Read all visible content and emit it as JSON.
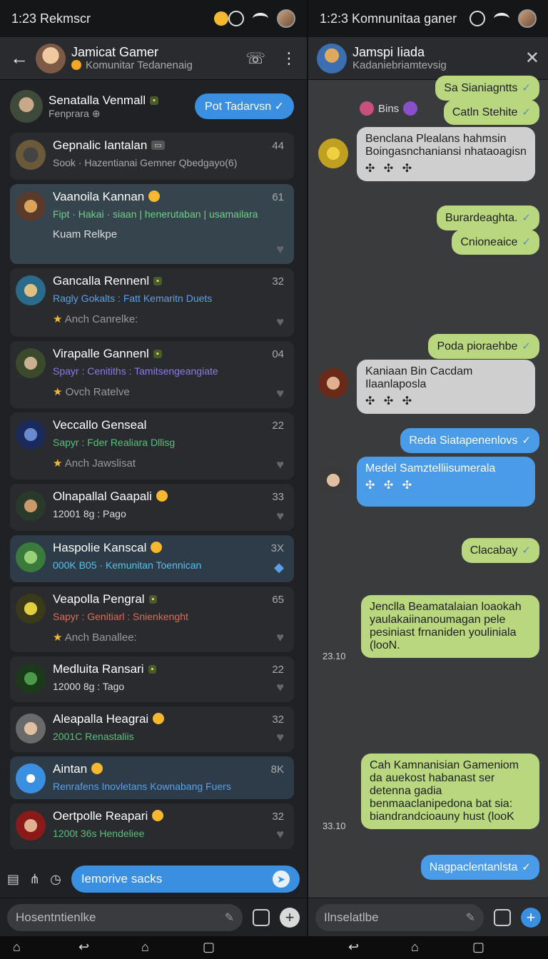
{
  "left": {
    "status": {
      "time": "1:23 Rekmscr"
    },
    "header": {
      "title": "Jamicat Gamer",
      "subtitle": "Komunitar Tedanenaig"
    },
    "pinned": {
      "title": "Senatalla Venmall",
      "subtitle": "Fenprara",
      "button": "Pot Tadarvsn"
    },
    "cards": [
      {
        "title": "Gepnalic Iantalan",
        "line": "Sook · Hazentianai Gemner Qbedgayo(6)",
        "meta": "",
        "count": "44",
        "style": ""
      },
      {
        "title": "Vaanoila Kannan",
        "line": "Fipt · Hakai · siaan | henerutaban | usamailara",
        "meta": "Kuam Relkpe",
        "count": "61",
        "style": "hl"
      },
      {
        "title": "Gancalla Rennenl",
        "line": "Ragly Gokalts : Fatt Kemaritn Duets",
        "meta": "Anch Canrelke:",
        "count": "32",
        "style": ""
      },
      {
        "title": "Virapalle Gannenl",
        "line": "Spayr : Cenitiths : Tamitsengeangiate",
        "meta": "Ovch Ratelve",
        "count": "04",
        "style": ""
      },
      {
        "title": "Veccallo Genseal",
        "line": "Sapyr : Fder Realiara Dllisg",
        "meta": "Anch Jawslisat",
        "count": "22",
        "style": ""
      },
      {
        "title": "Olnapallal Gaapali",
        "line": "12001 8g : Pago",
        "meta": "",
        "count": "33",
        "style": ""
      },
      {
        "title": "Haspolie Kanscal",
        "line": "000K B05 · Kemunitan Toennican",
        "meta": "",
        "count": "3X",
        "style": "blue"
      },
      {
        "title": "Veapolla Pengral",
        "line": "Sapyr : Genitiarl : Snienkenght",
        "meta": "Anch Banallee:",
        "count": "65",
        "style": ""
      },
      {
        "title": "Medluita Ransari",
        "line": "12000 8g : Tago",
        "meta": "",
        "count": "22",
        "style": ""
      },
      {
        "title": "Aleapalla Heagrai",
        "line": "2001C Renastaliis",
        "meta": "",
        "count": "32",
        "style": ""
      },
      {
        "title": "Aintan",
        "line": "Renrafens Inovletans Kownabang Fuers",
        "meta": "",
        "count": "8K",
        "style": "blue"
      },
      {
        "title": "Oertpolle Reapari",
        "line": "1200t 36s Hendeliee",
        "meta": "",
        "count": "32",
        "style": ""
      }
    ],
    "suggest": "Iemorive sacks",
    "input_placeholder": "Hosentntienlke"
  },
  "right": {
    "status": {
      "time": "1:2:3 Komnunitaa ganer"
    },
    "header": {
      "title": "Jamspi Iiada",
      "subtitle": "Kadaniebriamtevsig"
    },
    "messages": {
      "m1": "Sa Sianiagntts",
      "bins": "Bins",
      "m2": "Catln Stehite",
      "m3": "Benclana Plealans hahmsin Boingasnchaniansi nhataoagisn",
      "m4": "Burardeaghta.",
      "m5": "Cnioneaice",
      "m6": "Poda pioraehbe",
      "m7": "Kaniaan Bin Cacdam Ilaanlaposla",
      "m8": "Reda Siatapenenlovs",
      "m9": "Medel Samztelliisumerala",
      "m10": "Clacabay",
      "m11": "Jenclla Beamatalaian loaokah yaulakaiinanoumagan pele pesiniast frnaniden youliniala (looN.",
      "ts1": "23.10",
      "m12": "Cah Kamnanisian Gameniom da auekost habanast ser detenna gadia benmaaclanipedona bat sia: biandrandcioauny hust (looK",
      "ts2": "33.10",
      "m13": "Nagpaclentanlsta"
    },
    "input_placeholder": "Ilnselatlbe"
  }
}
